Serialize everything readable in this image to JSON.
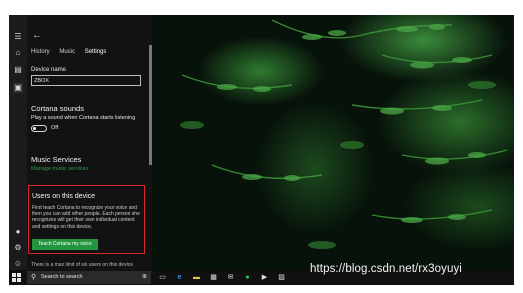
{
  "panel": {
    "tabs": [
      {
        "label": "History"
      },
      {
        "label": "Music"
      },
      {
        "label": "Settings"
      }
    ],
    "device_name_label": "Device name",
    "device_name_value": "ZBOX",
    "cortana_sounds_heading": "Cortana sounds",
    "cortana_sounds_desc": "Play a sound when Cortana starts listening",
    "toggle_state": "Off",
    "music_services_heading": "Music Services",
    "manage_music_link": "Manage music services",
    "users_heading": "Users on this device",
    "users_desc": "First teach Cortana to recognize your voice and then you can add other people. Each person she recognizes will get their own individual content and settings on this device.",
    "teach_button": "Teach Cortana my voice",
    "limit_text": "There is a max limit of six users on this device"
  },
  "taskbar": {
    "search_placeholder": "Search to search"
  },
  "watermark": "https://blog.csdn.net/rx3oyuyi",
  "colors": {
    "accent_green": "#25943f",
    "link_green": "#2d9a4a",
    "highlight_red": "#d6282b",
    "panel_bg": "#121212"
  },
  "icons": [
    "hamburger-icon",
    "home-icon",
    "notebook-icon",
    "devices-icon",
    "lightbulb-icon",
    "gear-icon",
    "feedback-icon",
    "windows-start-icon",
    "search-icon",
    "microphone-icon",
    "task-view-icon",
    "edge-icon",
    "file-explorer-icon",
    "store-icon",
    "mail-icon",
    "spotify-icon",
    "media-icon",
    "photos-icon"
  ]
}
